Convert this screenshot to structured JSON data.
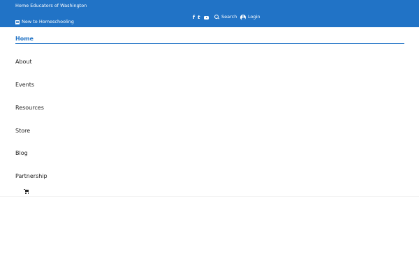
{
  "topbar": {
    "org_name": "Home Educators of Washington",
    "new_link_label": "New to Homeschooling",
    "search_label": "Search",
    "login_label": "Login",
    "social_icons": [
      "facebook-icon",
      "twitter-icon",
      "youtube-icon"
    ],
    "background_color": "#2173c6"
  },
  "nav": {
    "items": [
      {
        "label": "Home",
        "active": true
      },
      {
        "label": "About"
      },
      {
        "label": "Events"
      },
      {
        "label": "Resources"
      },
      {
        "label": "Store"
      },
      {
        "label": "Blog"
      },
      {
        "label": "Partnership"
      }
    ],
    "cart_icon": "cart-icon",
    "accent_color": "#2173c6"
  },
  "icons": {
    "facebook": "f",
    "twitter": "t"
  }
}
